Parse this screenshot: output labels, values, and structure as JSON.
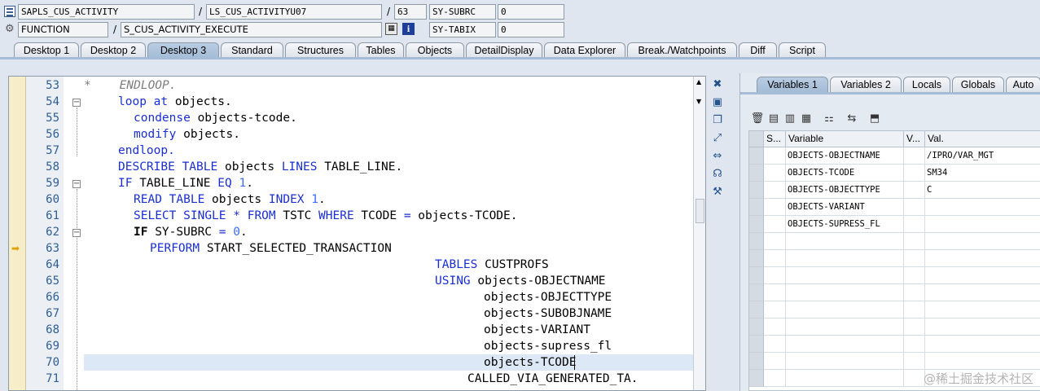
{
  "header": {
    "row1": {
      "program": "SAPLS_CUS_ACTIVITY",
      "include": "LS_CUS_ACTIVITYU07",
      "line": "63",
      "sysvar_label": "SY-SUBRC",
      "sysvar_value": "0"
    },
    "row2": {
      "type": "FUNCTION",
      "name": "S_CUS_ACTIVITY_EXECUTE",
      "sysvar_label": "SY-TABIX",
      "sysvar_value": "0"
    },
    "separator": "/"
  },
  "tabs": [
    "Desktop 1",
    "Desktop 2",
    "Desktop 3",
    "Standard",
    "Structures",
    "Tables",
    "Objects",
    "DetailDisplay",
    "Data Explorer",
    "Break./Watchpoints",
    "Diff",
    "Script"
  ],
  "active_tab": "Desktop 3",
  "code_lines": [
    {
      "n": "53",
      "t": "*    ENDLOOP."
    },
    {
      "n": "54",
      "t": "loop at objects."
    },
    {
      "n": "55",
      "t": "condense objects-tcode."
    },
    {
      "n": "56",
      "t": "modify objects."
    },
    {
      "n": "57",
      "t": "endloop."
    },
    {
      "n": "58",
      "t": "DESCRIBE TABLE objects LINES TABLE_LINE."
    },
    {
      "n": "59",
      "t": "IF TABLE_LINE EQ 1."
    },
    {
      "n": "60",
      "t": "READ TABLE objects INDEX 1."
    },
    {
      "n": "61",
      "t": "SELECT SINGLE * FROM TSTC WHERE TCODE = objects-TCODE."
    },
    {
      "n": "62",
      "t": "IF SY-SUBRC = 0."
    },
    {
      "n": "63",
      "t": "PERFORM START_SELECTED_TRANSACTION"
    },
    {
      "n": "64",
      "t": "TABLES CUSTPROFS"
    },
    {
      "n": "65",
      "t": "USING objects-OBJECTNAME"
    },
    {
      "n": "66",
      "t": "objects-OBJECTTYPE"
    },
    {
      "n": "67",
      "t": "objects-SUBOBJNAME"
    },
    {
      "n": "68",
      "t": "objects-VARIANT"
    },
    {
      "n": "69",
      "t": "objects-supress_fl"
    },
    {
      "n": "70",
      "t": "objects-TCODE"
    },
    {
      "n": "71",
      "t": "CALLED_VIA_GENERATED_TA."
    }
  ],
  "right_tabs": [
    "Variables 1",
    "Variables 2",
    "Locals",
    "Globals",
    "Auto"
  ],
  "right_active_tab": "Variables 1",
  "grid": {
    "headers": [
      "S...",
      "Variable",
      "V...",
      "Val."
    ],
    "rows": [
      {
        "variable": "OBJECTS-OBJECTNAME",
        "value": "/IPRO/VAR_MGT"
      },
      {
        "variable": "OBJECTS-TCODE",
        "value": "SM34"
      },
      {
        "variable": "OBJECTS-OBJECTTYPE",
        "value": "C"
      },
      {
        "variable": "OBJECTS-VARIANT",
        "value": ""
      },
      {
        "variable": "OBJECTS-SUPRESS_FL",
        "value": ""
      }
    ]
  },
  "watermark": "@稀土掘金技术社区"
}
